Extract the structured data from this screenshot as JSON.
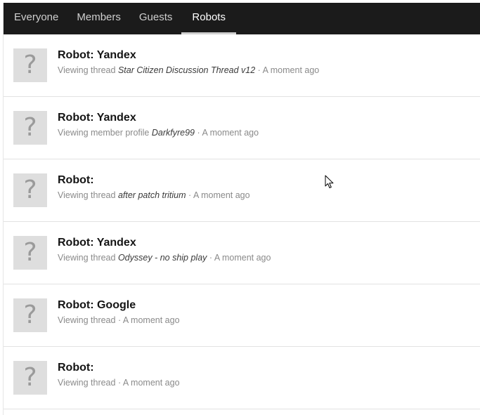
{
  "tabs": [
    {
      "label": "Everyone",
      "active": false
    },
    {
      "label": "Members",
      "active": false
    },
    {
      "label": "Guests",
      "active": false
    },
    {
      "label": "Robots",
      "active": true
    }
  ],
  "rows": [
    {
      "avatar": "?",
      "name": "Robot: Yandex",
      "action": "Viewing thread",
      "target": "Star Citizen Discussion Thread v12",
      "sep": "·",
      "time": "A moment ago"
    },
    {
      "avatar": "?",
      "name": "Robot: Yandex",
      "action": "Viewing member profile",
      "target": "Darkfyre99",
      "sep": "·",
      "time": "A moment ago"
    },
    {
      "avatar": "?",
      "name": "Robot:",
      "action": "Viewing thread",
      "target": "after patch tritium",
      "sep": "·",
      "time": "A moment ago"
    },
    {
      "avatar": "?",
      "name": "Robot: Yandex",
      "action": "Viewing thread",
      "target": "Odyssey - no ship play",
      "sep": "·",
      "time": "A moment ago"
    },
    {
      "avatar": "?",
      "name": "Robot: Google",
      "action": "Viewing thread",
      "target": "",
      "sep": "·",
      "time": "A moment ago"
    },
    {
      "avatar": "?",
      "name": "Robot:",
      "action": "Viewing thread",
      "target": "",
      "sep": "·",
      "time": "A moment ago"
    }
  ],
  "colors": {
    "tab_bar_bg": "#1b1b1b",
    "active_tab_underline": "#cfcfcf",
    "avatar_bg": "#dedede",
    "muted_text": "#8a8a8a"
  }
}
